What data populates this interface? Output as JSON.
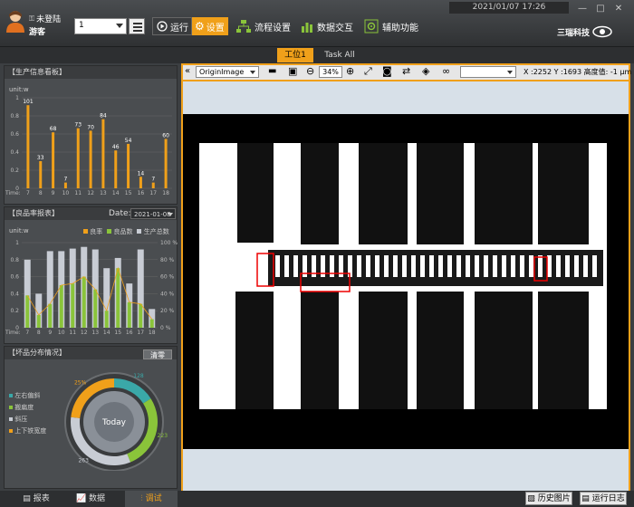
{
  "header": {
    "user_status": "未登陆",
    "user_role": "游客",
    "station_select_value": "1",
    "run_label": "运行",
    "settings_label": "设置",
    "flow_label": "流程设置",
    "data_label": "数据交互",
    "aux_label": "辅助功能",
    "datetime": "2021/01/07  17:26",
    "brand": "三瑞科技"
  },
  "tabs": [
    {
      "label": "工位1",
      "active": true
    },
    {
      "label": "Task All",
      "active": false
    }
  ],
  "panel_production": {
    "title": "【生产信息看板】",
    "unit_label": "unit:w",
    "y_ticks": [
      "1",
      "0.8",
      "0.6",
      "0.4",
      "0.2",
      "0"
    ],
    "x_label": "Time",
    "categories": [
      "7",
      "8",
      "9",
      "10",
      "11",
      "12",
      "13",
      "14",
      "15",
      "16",
      "17",
      "18"
    ],
    "values": [
      101,
      33,
      68,
      7,
      73,
      70,
      84,
      46,
      54,
      14,
      7,
      60
    ],
    "accent": "#f0a01a"
  },
  "panel_yield": {
    "title": "【良品率报表】",
    "date_label": "Date:",
    "date_value": "2021-01-08",
    "unit_label": "unit:w",
    "legend": [
      "良率",
      "良品数",
      "生产总数"
    ],
    "y_ticks": [
      "1",
      "0.8",
      "0.6",
      "0.4",
      "0.2",
      "0"
    ],
    "y_ticks_right": [
      "100 %",
      "80 %",
      "60 %",
      "40 %",
      "20 %",
      "0 %"
    ],
    "x_label": "Time",
    "categories": [
      "7",
      "8",
      "9",
      "10",
      "11",
      "12",
      "13",
      "14",
      "15",
      "16",
      "17",
      "18"
    ],
    "total": [
      0.8,
      0.4,
      0.9,
      0.9,
      0.93,
      0.95,
      0.92,
      0.7,
      0.82,
      0.52,
      0.92,
      0.22
    ],
    "good": [
      0.38,
      0.15,
      0.28,
      0.5,
      0.52,
      0.6,
      0.45,
      0.2,
      0.7,
      0.3,
      0.28,
      0.1
    ],
    "colors": {
      "good": "#8ac43a",
      "total": "#c8ccd4",
      "rate": "#f0a01a"
    }
  },
  "panel_defect": {
    "title": "【坏品分布情况】",
    "clear_label": "清零",
    "legend": [
      "左右偏斜",
      "搬扁度",
      "斜压",
      "上下铁宽度"
    ],
    "center_label": "Today",
    "slices": [
      {
        "label": "128",
        "value": 128,
        "color": "#3aa8a8"
      },
      {
        "label": "223",
        "value": 223,
        "color": "#8ac43a"
      },
      {
        "label": "263",
        "value": 263,
        "color": "#c8ccd4"
      },
      {
        "label": "25%",
        "value": 186,
        "color": "#f0a01a"
      }
    ]
  },
  "viewer": {
    "image_select": "OriginImage",
    "zoom": "34%",
    "coord_readout": "X :2252 Y :1693 高度值: -1 μm"
  },
  "bottom": {
    "tabs": [
      "报表",
      "数据",
      "调试"
    ],
    "active_tab": "调试",
    "history_label": "历史图片",
    "log_label": "运行日志"
  }
}
